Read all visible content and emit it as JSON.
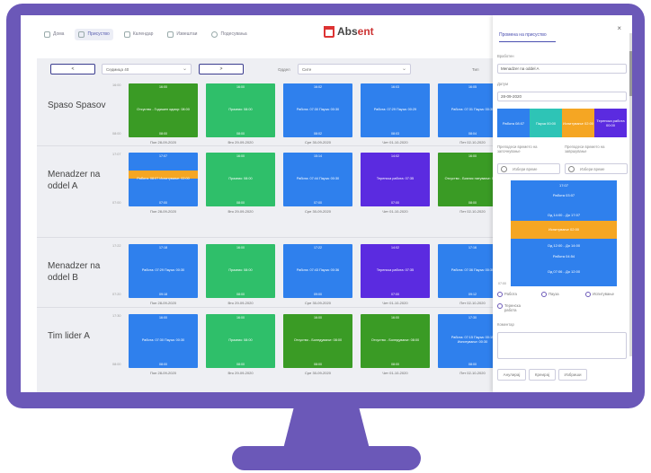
{
  "nav": {
    "items": [
      "Дома",
      "Присуство",
      "Календар",
      "Извештаи",
      "Подесувања"
    ]
  },
  "logo": {
    "abs": "Abs",
    "ent": "ent"
  },
  "controls": {
    "prev": "<",
    "next": ">",
    "week": "Седмица 40",
    "sector_label": "Оддел",
    "sector_value": "Сите",
    "type_label": "Тип"
  },
  "days": [
    "Пон 28-09-2020",
    "Вто 29-09-2020",
    "Сре 30-09-2020",
    "Чет 01-10-2020",
    "Пет 02-10-2020"
  ],
  "rows": [
    {
      "name": "Spaso Spasov",
      "start": "16:00",
      "end": "08:00",
      "days": [
        {
          "top": "16:00",
          "label": "Отсуство - Годишен одмор: 08:00",
          "bottom": "08:00"
        },
        {
          "top": "16:00",
          "label": "Празник: 08:00",
          "bottom": "08:00"
        },
        {
          "top": "16:02",
          "label": "Работа: 07:30 Пауза: 00:30",
          "bottom": "08:02"
        },
        {
          "top": "16:03",
          "label": "Работа: 07:29 Пауза: 00:29",
          "bottom": "08:03"
        },
        {
          "top": "16:05",
          "label": "Работа: 07:31 Пауза: 00:30",
          "bottom": "08:04"
        }
      ]
    },
    {
      "name": "Menadzer na oddel A",
      "start": "17:07",
      "end": "07:00",
      "days": [
        {
          "top": "17:07",
          "label": "Работа: 08:07 Испитување: 02:00",
          "bottom": "07:00"
        },
        {
          "top": "16:00",
          "label": "Празник: 08:00",
          "bottom": "08:00"
        },
        {
          "top": "15:14",
          "label": "Работа: 07:44 Пауза: 00:30",
          "bottom": "07:00"
        },
        {
          "top": "14:02",
          "label": "Теренска работа: 07:35",
          "bottom": "07:00"
        },
        {
          "top": "16:00",
          "label": "Отсуство - Бизнис патување: 08:00",
          "bottom": "08:00"
        }
      ]
    },
    {
      "name": "Menadzer na oddel B",
      "start": "17:22",
      "end": "07:20",
      "days": [
        {
          "top": "17:18",
          "label": "Работа: 07:29 Пауза: 00:30",
          "bottom": "09:18"
        },
        {
          "top": "16:00",
          "label": "Празник: 08:00",
          "bottom": "08:00"
        },
        {
          "top": "17:22",
          "label": "Работа: 07:43 Пауза: 00:36",
          "bottom": "09:00"
        },
        {
          "top": "14:02",
          "label": "Теренска работа: 07:35",
          "bottom": "07:00"
        },
        {
          "top": "17:16",
          "label": "Работа: 07:36 Пауза: 00:30",
          "bottom": "09:12"
        }
      ]
    },
    {
      "name": "Tim lider A",
      "start": "17:30",
      "end": "08:00",
      "days": [
        {
          "top": "16:00",
          "label": "Работа: 07:30 Пауза: 00:30",
          "bottom": "08:00"
        },
        {
          "top": "16:00",
          "label": "Празник: 08:00",
          "bottom": "08:00"
        },
        {
          "top": "16:00",
          "label": "Отсуство - Боледување: 08:00",
          "bottom": "08:00"
        },
        {
          "top": "16:00",
          "label": "Отсуство - Боледување: 08:00",
          "bottom": "08:00"
        },
        {
          "top": "17:30",
          "label": "Работа: 07:15 Пауза: 00:15 Испитување: 00:30",
          "bottom": "08:00"
        }
      ]
    }
  ],
  "panel": {
    "title": "Промена на присуство",
    "close": "×",
    "employee_label": "Вработен",
    "employee_value": "Menadzer na oddel A",
    "date_label": "Датум",
    "date_value": "28-09-2020",
    "legend": [
      "Работа 08:07",
      "Пауза 00:00",
      "Испитување 02:00",
      "Теренска работа 00:00"
    ],
    "from_label": "Преподеси времето на започнување",
    "to_label": "Преподеси времето на завршување",
    "time_placeholder": "Избери време",
    "timeline": {
      "top_time": "17:07",
      "work": "Работа 03:07",
      "range1": "Од 14:00 - До 17:07",
      "exam": "Испитување 02:00",
      "range2": "Од 12:00 - До 14:00",
      "work2": "Работа 04:54",
      "range3": "Од 07:06 - До 12:00",
      "bottom_time": "07:00"
    },
    "radios": [
      "Работа",
      "Пауза",
      "Испитување",
      "Теренска работа"
    ],
    "comment_label": "Коментар",
    "buttons": [
      "Анулирај",
      "Креирај",
      "Избриши"
    ]
  },
  "colors": {
    "green": "#3a9b25",
    "light_green": "#2fbf6a",
    "blue": "#2f80ed",
    "purple": "#5b2be0",
    "orange": "#f5a623",
    "teal": "#2ec4b6",
    "frame": "#6b58b8"
  }
}
